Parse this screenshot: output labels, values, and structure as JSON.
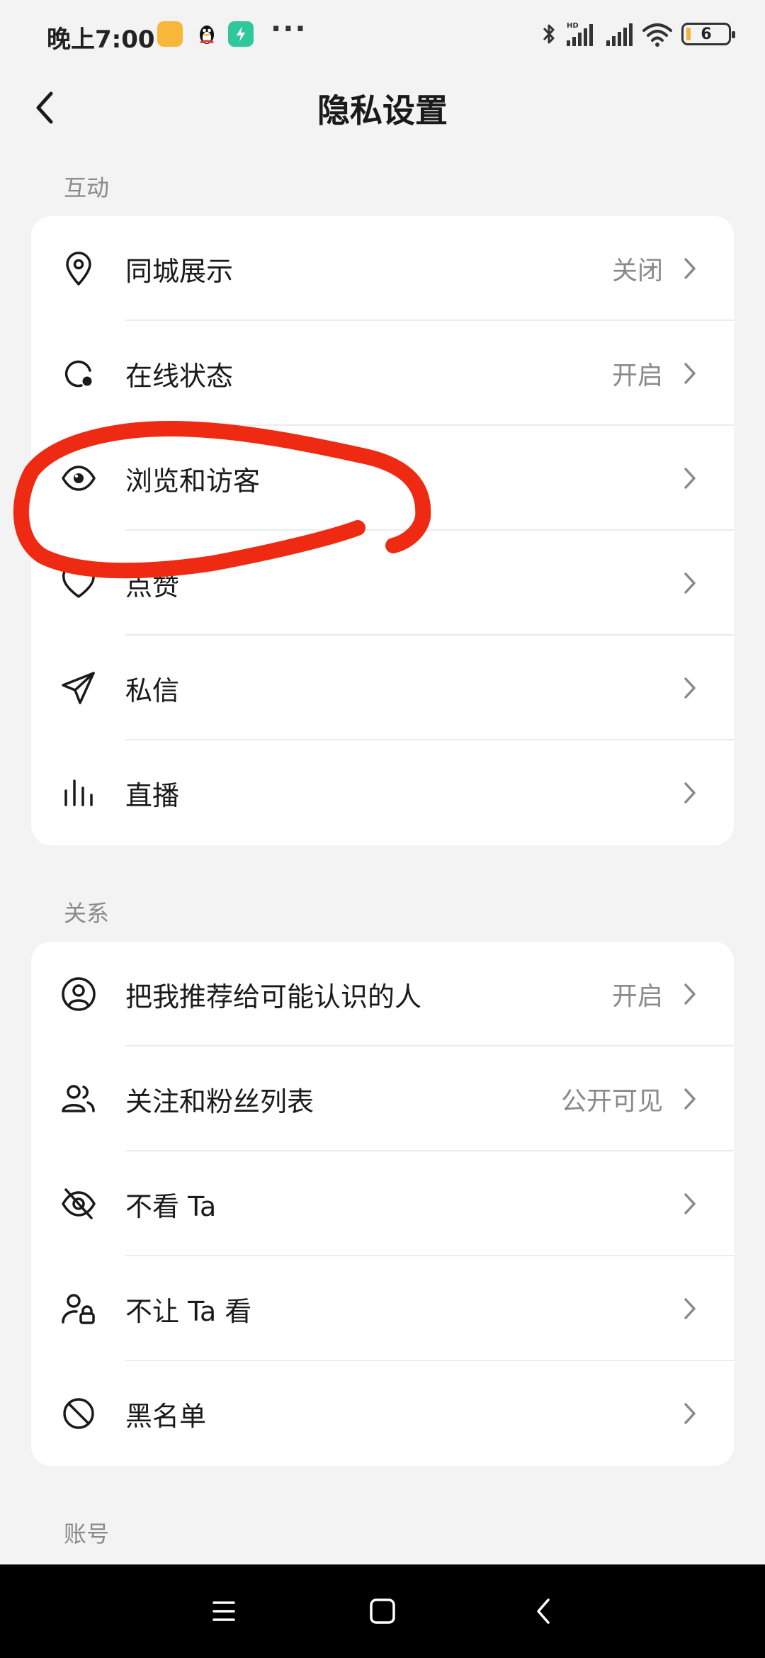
{
  "status_bar": {
    "time": "晚上7:00",
    "battery": "6"
  },
  "header": {
    "title": "隐私设置"
  },
  "sections": [
    {
      "label": "互动",
      "items": [
        {
          "label": "同城展示",
          "value": "关闭",
          "icon": "location-pin-icon"
        },
        {
          "label": "在线状态",
          "value": "开启",
          "icon": "online-status-icon"
        },
        {
          "label": "浏览和访客",
          "value": "",
          "icon": "eye-icon"
        },
        {
          "label": "点赞",
          "value": "",
          "icon": "heart-icon"
        },
        {
          "label": "私信",
          "value": "",
          "icon": "send-icon"
        },
        {
          "label": "直播",
          "value": "",
          "icon": "live-bars-icon"
        }
      ]
    },
    {
      "label": "关系",
      "items": [
        {
          "label": "把我推荐给可能认识的人",
          "value": "开启",
          "icon": "user-circle-icon"
        },
        {
          "label": "关注和粉丝列表",
          "value": "公开可见",
          "icon": "users-icon"
        },
        {
          "label": "不看 Ta",
          "value": "",
          "icon": "eye-off-icon"
        },
        {
          "label": "不让 Ta 看",
          "value": "",
          "icon": "user-lock-icon"
        },
        {
          "label": "黑名单",
          "value": "",
          "icon": "block-icon"
        }
      ]
    },
    {
      "label": "账号",
      "items": []
    }
  ],
  "colors": {
    "background": "#f3f3f3",
    "card": "#ffffff",
    "secondary_text": "#8a8a8a",
    "annotation_stroke": "#ee2a12"
  }
}
